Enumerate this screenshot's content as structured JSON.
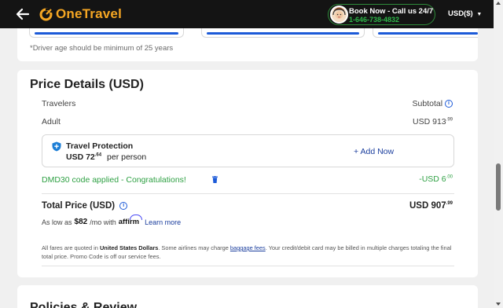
{
  "header": {
    "brand": "OneTravel",
    "call_line1": "Book Now - Call us 24/7",
    "call_line2": "1-646-738-4832",
    "currency": "USD($)"
  },
  "driver_note": "*Driver age should be minimum of 25 years",
  "price_details": {
    "title": "Price Details (USD)",
    "travelers_label": "Travelers",
    "subtotal_label": "Subtotal",
    "adult_label": "Adult",
    "adult_amount_main": "USD 913",
    "adult_amount_cents": ".99",
    "travel_protection": {
      "title": "Travel Protection",
      "price_main": "USD 72",
      "price_cents": ".64",
      "per": "per person",
      "add_label": "+ Add Now"
    },
    "promo_text": "DMD30 code applied - Congratulations!",
    "promo_amount_main": "-USD 6",
    "promo_amount_cents": ".00",
    "total_label": "Total Price (USD)",
    "total_main": "USD 907",
    "total_cents": ".99",
    "affirm_prefix": "As low as",
    "affirm_amount": "$82",
    "affirm_suffix": "/mo with",
    "affirm_brand": "affirm",
    "learn_more": "Learn more",
    "fine_print_1": "All fares are quoted in",
    "fine_print_currency": "United States Dollars",
    "fine_print_2": ". Some airlines may charge",
    "fine_print_link": "baggage fees",
    "fine_print_3": ". Your credit/debit card may be billed in multiple charges totaling the final total price. Promo Code is off our service fees."
  },
  "policies_title": "Policies & Review",
  "colors": {
    "brand_orange": "#f5a623",
    "link_blue": "#1c3f9e",
    "promo_green": "#2ea043",
    "header_bg": "#141414"
  }
}
